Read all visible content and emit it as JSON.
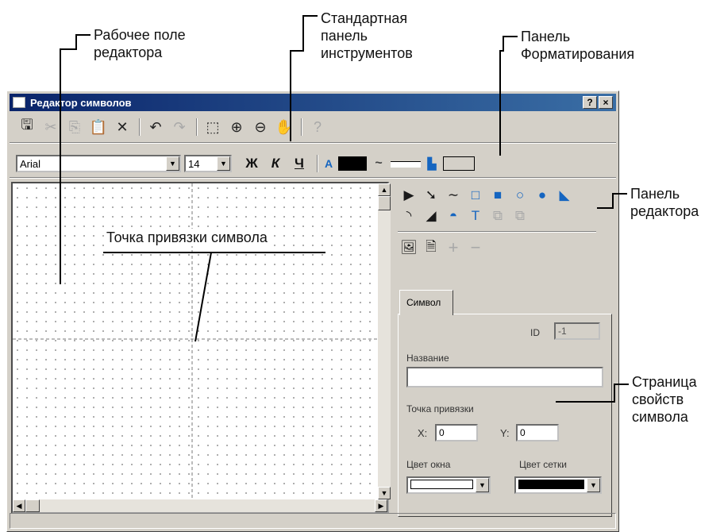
{
  "callouts": {
    "workspace": [
      "Рабочее поле",
      "редактора"
    ],
    "standard_toolbar": [
      "Стандартная",
      "панель",
      "инструментов"
    ],
    "format_toolbar": [
      "Панель",
      "Форматирования"
    ],
    "editor_panel": [
      "Панель",
      "редактора"
    ],
    "anchor_point": "Точка привязки символа",
    "properties_page": [
      "Страница",
      "свойств",
      "символа"
    ]
  },
  "window": {
    "title": "Редактор символов",
    "help_button": "?",
    "close_button": "×"
  },
  "standard_toolbar": {
    "buttons": [
      {
        "icon": "save-icon",
        "glyph": "🖫",
        "enabled": true
      },
      {
        "icon": "cut-icon",
        "glyph": "✂",
        "enabled": false
      },
      {
        "icon": "copy-icon",
        "glyph": "⎘",
        "enabled": false
      },
      {
        "icon": "paste-icon",
        "glyph": "📋",
        "enabled": true
      },
      {
        "icon": "delete-icon",
        "glyph": "✕",
        "enabled": true
      },
      {
        "icon": "undo-icon",
        "glyph": "↶",
        "enabled": true
      },
      {
        "icon": "redo-icon",
        "glyph": "↷",
        "enabled": false
      },
      {
        "icon": "select-icon",
        "glyph": "⬚",
        "enabled": true
      },
      {
        "icon": "zoom-in-icon",
        "glyph": "⊕",
        "enabled": true
      },
      {
        "icon": "zoom-out-icon",
        "glyph": "⊖",
        "enabled": true
      },
      {
        "icon": "pan-hand-icon",
        "glyph": "✋",
        "enabled": true
      },
      {
        "icon": "help-icon",
        "glyph": "?",
        "enabled": false
      }
    ]
  },
  "format_toolbar": {
    "font": "Arial",
    "size": "14",
    "bold": "Ж",
    "italic": "К",
    "underline": "Ч",
    "text_color_letter": "A",
    "line_style_glyph": "~",
    "fill_glyph": "▙"
  },
  "colors": {
    "title_start": "#0a246a",
    "title_end": "#3a6ea5",
    "face": "#d4d0c8",
    "accent_blue": "#1565c0"
  },
  "editor_palette": {
    "row1": [
      {
        "icon": "arrow-select-icon",
        "glyph": "▶"
      },
      {
        "icon": "node-select-icon",
        "glyph": "➘"
      },
      {
        "icon": "freeline-icon",
        "glyph": "∼"
      },
      {
        "icon": "rectangle-icon",
        "glyph": "□"
      },
      {
        "icon": "filled-rectangle-icon",
        "glyph": "■"
      },
      {
        "icon": "ellipse-icon",
        "glyph": "○"
      },
      {
        "icon": "filled-ellipse-icon",
        "glyph": "●"
      },
      {
        "icon": "polygon-icon",
        "glyph": "◣"
      }
    ],
    "row2": [
      {
        "icon": "arc-icon",
        "glyph": "◝"
      },
      {
        "icon": "sector-icon",
        "glyph": "◢"
      },
      {
        "icon": "segment-icon",
        "glyph": "◓"
      },
      {
        "icon": "text-tool-icon",
        "glyph": "T"
      },
      {
        "icon": "bring-front-icon",
        "glyph": "⧉"
      },
      {
        "icon": "send-back-icon",
        "glyph": "⧉"
      }
    ],
    "row3": [
      {
        "icon": "image-icon",
        "glyph": "🖼"
      },
      {
        "icon": "import-image-icon",
        "glyph": "🗎"
      },
      {
        "icon": "add-point-icon",
        "glyph": "+"
      },
      {
        "icon": "remove-point-icon",
        "glyph": "−"
      }
    ]
  },
  "properties": {
    "tab_label": "Символ",
    "id_label": "ID",
    "id_value": "-1",
    "name_label": "Название",
    "name_value": "",
    "anchor_label": "Точка привязки",
    "x_label": "X:",
    "x_value": "0",
    "y_label": "Y:",
    "y_value": "0",
    "window_color_label": "Цвет окна",
    "window_color_value": "#ffffff",
    "grid_color_label": "Цвет сетки",
    "grid_color_value": "#000000"
  }
}
